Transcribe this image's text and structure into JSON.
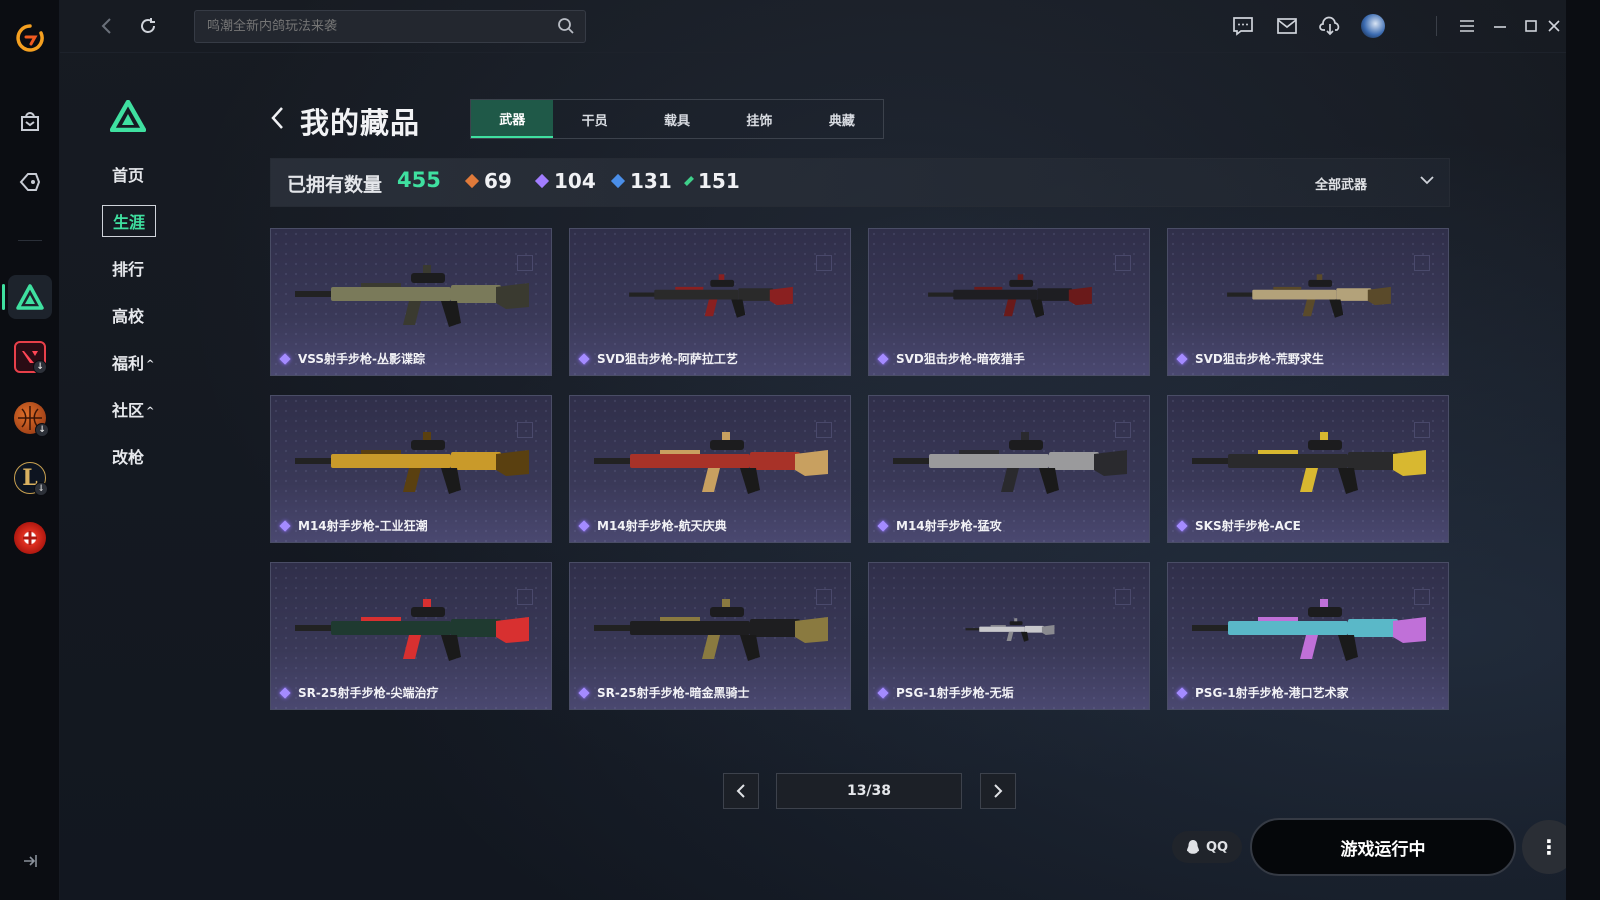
{
  "rail": {
    "logo_icon": "app-logo-icon",
    "items": [
      {
        "name": "store-icon"
      },
      {
        "name": "tag-icon"
      },
      {
        "name": "delta-force-icon",
        "active": true
      },
      {
        "name": "valorant-icon",
        "badge": "download-icon"
      },
      {
        "name": "basketball-game-icon",
        "badge": "download-icon"
      },
      {
        "name": "lol-icon",
        "letter": "L",
        "badge": "download-icon"
      },
      {
        "name": "crossfire-icon"
      }
    ],
    "collapse_icon": "collapse-sidebar-icon"
  },
  "topbar": {
    "search_placeholder": "鸣潮全新内鸽玩法来袭",
    "icons": [
      "chat-icon",
      "mail-icon",
      "download-icon",
      "avatar",
      "menu-icon",
      "minimize-icon",
      "maximize-icon",
      "close-icon"
    ]
  },
  "leftnav": {
    "items": [
      {
        "label": "首页"
      },
      {
        "label": "生涯",
        "selected": true
      },
      {
        "label": "排行"
      },
      {
        "label": "高校"
      },
      {
        "label": "福利",
        "caret": "^"
      },
      {
        "label": "社区",
        "caret": "^"
      },
      {
        "label": "改枪"
      }
    ]
  },
  "header": {
    "title": "我的藏品",
    "tabs": [
      {
        "label": "武器",
        "active": true
      },
      {
        "label": "干员"
      },
      {
        "label": "载具"
      },
      {
        "label": "挂饰"
      },
      {
        "label": "典藏"
      }
    ]
  },
  "stats": {
    "owned_label": "已拥有数量",
    "owned_count": "455",
    "rarities": [
      {
        "value": "69",
        "color": "#e07a3a"
      },
      {
        "value": "104",
        "color": "#a27dff"
      },
      {
        "value": "131",
        "color": "#4a8ee8"
      },
      {
        "value": "151",
        "color": "#3fd08a"
      }
    ],
    "filter_label": "全部武器"
  },
  "items": [
    {
      "name": "VSS射手步枪-丛影谍踪",
      "body": "#7a7a5a",
      "accent": "#3a3a30"
    },
    {
      "name": "SVD狙击步枪-阿萨拉工艺",
      "body": "#2a2a2a",
      "accent": "#8a2020"
    },
    {
      "name": "SVD狙击步枪-暗夜猎手",
      "body": "#1e1e22",
      "accent": "#6a1a1a"
    },
    {
      "name": "SVD狙击步枪-荒野求生",
      "body": "#b3a27a",
      "accent": "#5a4a2a"
    },
    {
      "name": "M14射手步枪-工业狂潮",
      "body": "#c99a2a",
      "accent": "#5a4010"
    },
    {
      "name": "M14射手步枪-航天庆典",
      "body": "#a83228",
      "accent": "#c8a060"
    },
    {
      "name": "M14射手步枪-猛攻",
      "body": "#9a9a9c",
      "accent": "#2a2a2e"
    },
    {
      "name": "SKS射手步枪-ACE",
      "body": "#2a2a2c",
      "accent": "#d8b830"
    },
    {
      "name": "SR-25射手步枪-尖端治疗",
      "body": "#1f3a30",
      "accent": "#d83030"
    },
    {
      "name": "SR-25射手步枪-暗金黑骑士",
      "body": "#1e1e20",
      "accent": "#8a7a40"
    },
    {
      "name": "PSG-1射手步枪-无垢",
      "body": "#c8c8cc",
      "accent": "#8a8a90"
    },
    {
      "name": "PSG-1射手步枪-港口艺术家",
      "body": "#5ab8c8",
      "accent": "#c070d8"
    }
  ],
  "pagination": {
    "label": "13/38"
  },
  "footer": {
    "qq_label": "QQ",
    "run_label": "游戏运行中",
    "more_label": "⋮"
  }
}
